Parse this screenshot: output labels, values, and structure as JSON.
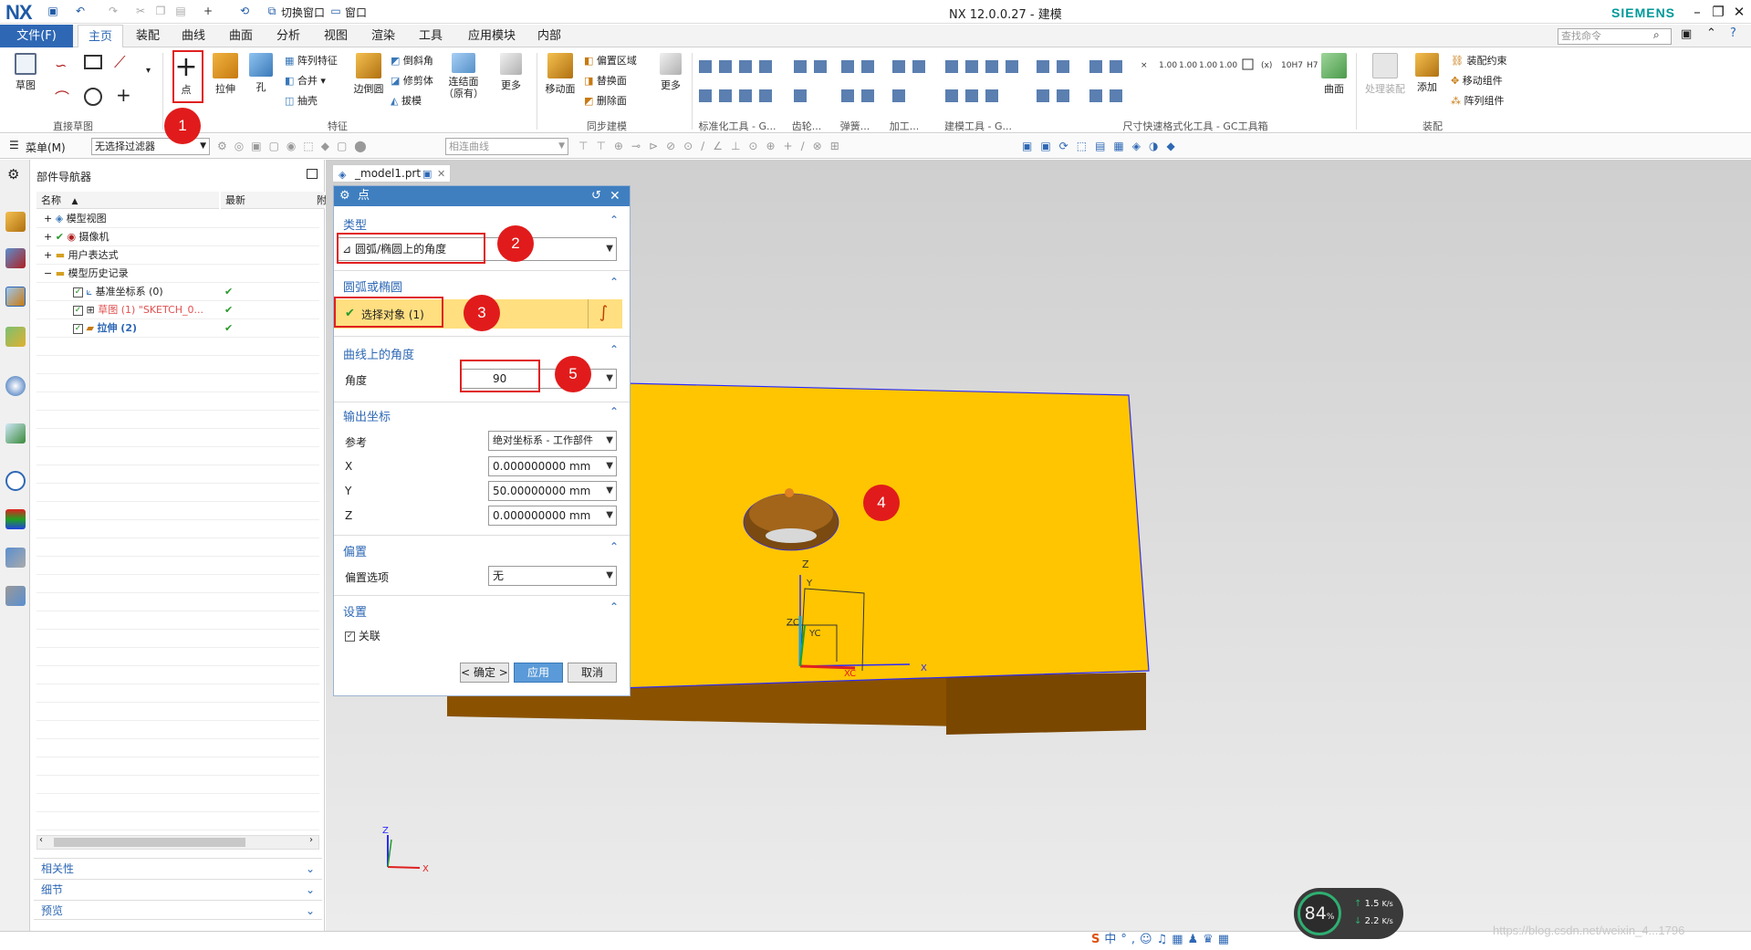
{
  "titlebar": {
    "logo": "NX",
    "title": "NX 12.0.0.27 - 建模",
    "brand": "SIEMENS",
    "switch_window": "切换窗口",
    "window": "窗口"
  },
  "menubar": {
    "file": "文件(F)",
    "tabs": [
      "主页",
      "装配",
      "曲线",
      "曲面",
      "分析",
      "视图",
      "渲染",
      "工具",
      "应用模块",
      "内部"
    ],
    "search_placeholder": "查找命令"
  },
  "ribbon": {
    "groups": [
      "直接草图",
      "特征",
      "同步建模",
      "标准化工具 - G...",
      "齿轮...",
      "弹簧...",
      "加工...",
      "建模工具 - G...",
      "尺寸快速格式化工具 - GC工具箱",
      "装配"
    ],
    "buttons": {
      "sketch": "草图",
      "point": "点",
      "extrude": "拉伸",
      "hole": "孔",
      "pattern_feature": "阵列特征",
      "unite": "合并",
      "shell": "抽壳",
      "edge_blend": "边倒圆",
      "chamfer": "倒斜角",
      "trim_body": "修剪体",
      "draft": "拔模",
      "unite_face": "连结面（原有）",
      "more1": "更多",
      "move_face": "移动面",
      "offset_region": "偏置区域",
      "replace_face": "替换面",
      "delete_face": "删除面",
      "more2": "更多",
      "surface": "曲面",
      "process_assembly": "处理装配",
      "add": "添加",
      "assembly_constraint": "装配约束",
      "move_component": "移动组件",
      "pattern_component": "阵列组件"
    }
  },
  "toolbar2": {
    "menu": "菜单(M)",
    "filter": "无选择过滤器",
    "curve_rule": "相连曲线"
  },
  "navigator": {
    "title": "部件导航器",
    "col_name": "名称",
    "col_latest": "最新",
    "col_extra": "附",
    "rows": [
      {
        "label": "模型视图"
      },
      {
        "label": "摄像机"
      },
      {
        "label": "用户表达式"
      },
      {
        "label": "模型历史记录"
      },
      {
        "label": "基准坐标系 (0)"
      },
      {
        "label": "草图 (1) \"SKETCH_0..."
      },
      {
        "label": "拉伸 (2)"
      }
    ],
    "panels": [
      "相关性",
      "细节",
      "预览"
    ]
  },
  "doc_tab": "_model1.prt",
  "dialog": {
    "title": "点",
    "sec_type": "类型",
    "type_value": "圆弧/椭圆上的角度",
    "sec_arc": "圆弧或椭圆",
    "select_object": "选择对象 (1)",
    "sec_angle": "曲线上的角度",
    "angle_label": "角度",
    "angle_value": "90",
    "sec_output": "输出坐标",
    "ref_label": "参考",
    "ref_value": "绝对坐标系 - 工作部件",
    "x_label": "X",
    "x_value": "0.000000000 mm",
    "y_label": "Y",
    "y_value": "50.00000000 mm",
    "z_label": "Z",
    "z_value": "0.000000000 mm",
    "sec_offset": "偏置",
    "offset_label": "偏置选项",
    "offset_value": "无",
    "sec_settings": "设置",
    "associative": "关联",
    "ok": "< 确定 >",
    "apply": "应用",
    "cancel": "取消"
  },
  "callouts": [
    "1",
    "2",
    "3",
    "4",
    "5"
  ],
  "viewport": {
    "axis_x": "X",
    "axis_y": "Y",
    "axis_z": "Z",
    "csys_xc": "XC",
    "csys_yc": "YC",
    "csys_zc": "ZC"
  },
  "net": {
    "percent": "84",
    "unit": "%",
    "up": "1.5",
    "down": "2.2",
    "rate_unit": "K/s"
  },
  "watermark": "https://blog.csdn.net/weixin_4...1796",
  "colors": {
    "accent": "#2e68b5",
    "plate_top": "#ffc500",
    "plate_side": "#8a5200",
    "badge": "#e11b1b"
  }
}
